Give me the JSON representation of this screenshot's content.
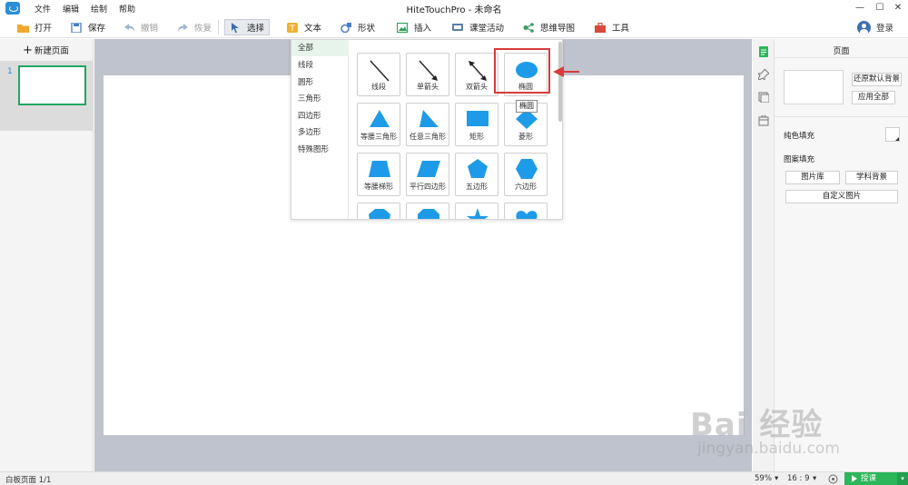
{
  "window": {
    "title": "HiteTouchPro - 未命名"
  },
  "menu": [
    "文件",
    "编辑",
    "绘制",
    "帮助"
  ],
  "toolbar": {
    "open": "打开",
    "save": "保存",
    "undo": "撤销",
    "redo": "恢复",
    "select": "选择",
    "text": "文本",
    "shape": "形状",
    "insert": "插入",
    "activity": "课堂活动",
    "mindmap": "思维导图",
    "tools": "工具",
    "login": "登录"
  },
  "left_panel": {
    "new_page": "新建页面",
    "page_number": "1"
  },
  "shape_popup": {
    "categories": [
      "全部",
      "线段",
      "圆形",
      "三角形",
      "四边形",
      "多边形",
      "特殊图形"
    ],
    "selected_category": "全部",
    "shapes": [
      "线段",
      "单箭头",
      "双箭头",
      "椭圆",
      "等腰三角形",
      "任意三角形",
      "矩形",
      "菱形",
      "等腰梯形",
      "平行四边形",
      "五边形",
      "六边形"
    ],
    "tooltip": "椭圆",
    "shape_color": "#1e9be8",
    "highlight_color": "#d83b3b"
  },
  "right_panel": {
    "title": "页面",
    "restore_bg": "还原默认背景",
    "apply_all": "应用全部",
    "solid_fill": "纯色填充",
    "pattern_fill": "图案填充",
    "gallery": "图片库",
    "subject_bg": "学科背景",
    "custom_image": "自定义图片"
  },
  "status": {
    "page": "白板页面 1/1",
    "zoom": "59%",
    "ratio": "16 : 9",
    "teach": "授课"
  },
  "watermark": {
    "main": "Bai 经验",
    "url": "jingyan.baidu.com"
  }
}
